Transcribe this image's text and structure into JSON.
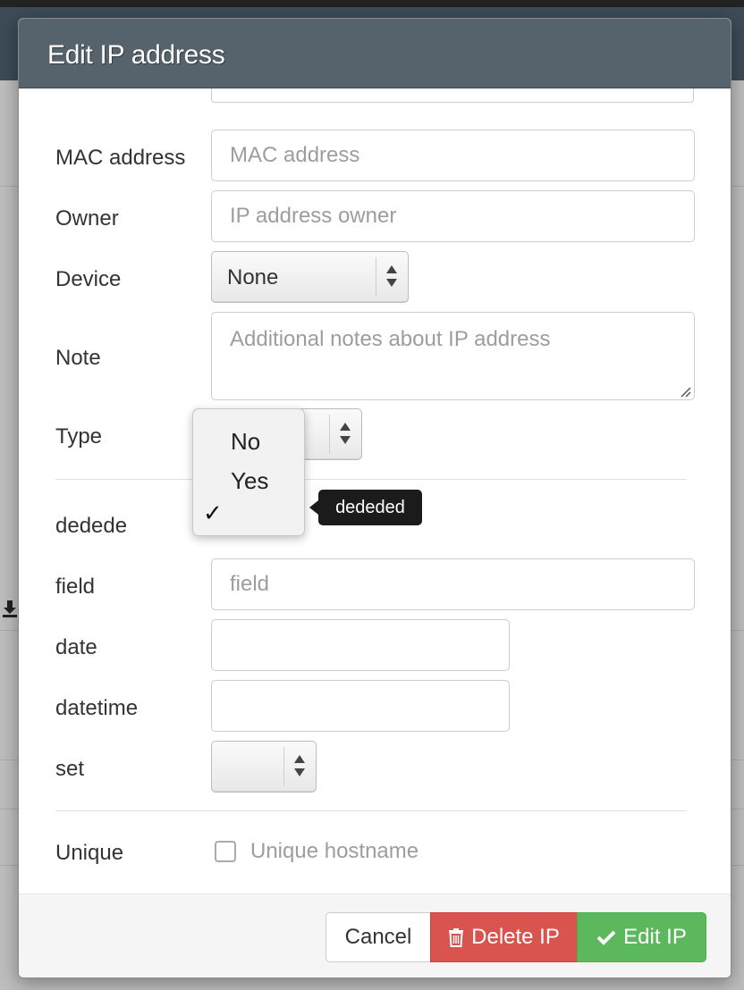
{
  "modal": {
    "title": "Edit IP address"
  },
  "form": {
    "mac": {
      "label": "MAC address",
      "placeholder": "MAC address"
    },
    "owner": {
      "label": "Owner",
      "placeholder": "IP address owner"
    },
    "device": {
      "label": "Device",
      "value": "None"
    },
    "note": {
      "label": "Note",
      "placeholder": "Additional notes about IP address"
    },
    "type": {
      "label": "Type"
    },
    "dedede": {
      "label": "dedede",
      "options": [
        "No",
        "Yes",
        ""
      ],
      "selected_index": 2,
      "tooltip": "dededed"
    },
    "field": {
      "label": "field",
      "placeholder": "field"
    },
    "date": {
      "label": "date"
    },
    "datetime": {
      "label": "datetime"
    },
    "set": {
      "label": "set"
    },
    "unique": {
      "label": "Unique",
      "checkbox_label": "Unique hostname",
      "checked": false
    }
  },
  "footer": {
    "cancel_label": "Cancel",
    "delete_label": "Delete IP",
    "edit_label": "Edit IP"
  },
  "icons": {
    "delete": "trash-icon",
    "edit": "check-icon",
    "selected": "checkmark-icon"
  },
  "colors": {
    "header": "#56636c",
    "danger": "#d9534f",
    "success": "#5cb85c",
    "tooltip": "#1b1b1b"
  }
}
